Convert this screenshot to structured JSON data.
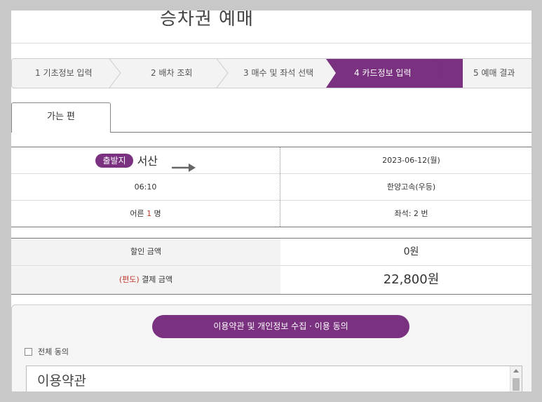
{
  "title": "승차권 예매",
  "steps": [
    {
      "label": "1 기초정보 입력",
      "active": false
    },
    {
      "label": "2 배차 조회",
      "active": false
    },
    {
      "label": "3 매수 및 좌석 선택",
      "active": false
    },
    {
      "label": "4 카드정보 입력",
      "active": true
    },
    {
      "label": "5 예매 결과",
      "active": false
    }
  ],
  "tab": {
    "label": "가는 편"
  },
  "trip": {
    "departure_badge": "출발지",
    "departure_city": "서산",
    "date": "2023-06-12(월)",
    "time": "06:10",
    "company": "한양고속(우등)",
    "passengers_prefix": "어른 ",
    "passengers_count": "1",
    "passengers_suffix": " 명",
    "seat": "좌석: 2 번"
  },
  "price": {
    "discount_label": "할인 금액",
    "discount_value": "0원",
    "card_label": "(편도)",
    "total_label": " 결제 금액",
    "total_value": "22,800원"
  },
  "terms": {
    "button_label": "이용약관 및 개인정보 수집 · 이용 동의",
    "check_all_label": "전체 동의",
    "textarea_title": "이용약관"
  },
  "colors": {
    "accent": "#7a3180",
    "red": "#c0392b"
  }
}
